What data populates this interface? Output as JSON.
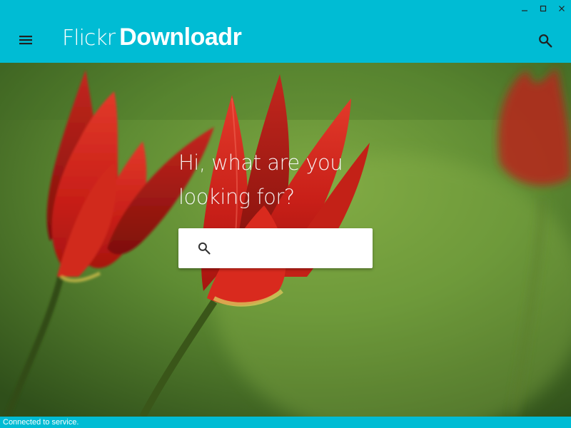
{
  "app": {
    "brand_light": "Flickr",
    "brand_bold": "Downloadr",
    "accent_color": "#00bcd4"
  },
  "window_controls": {
    "icons": [
      "minimize-icon",
      "maximize-icon",
      "close-icon"
    ]
  },
  "appbar": {
    "menu_icon": "menu-icon",
    "search_icon": "search-icon"
  },
  "hero": {
    "headline_line1": "Hi, what are you",
    "headline_line2": "looking for?",
    "search": {
      "value": "",
      "placeholder": "",
      "icon": "search-icon"
    }
  },
  "status": {
    "text": "Connected to service."
  }
}
